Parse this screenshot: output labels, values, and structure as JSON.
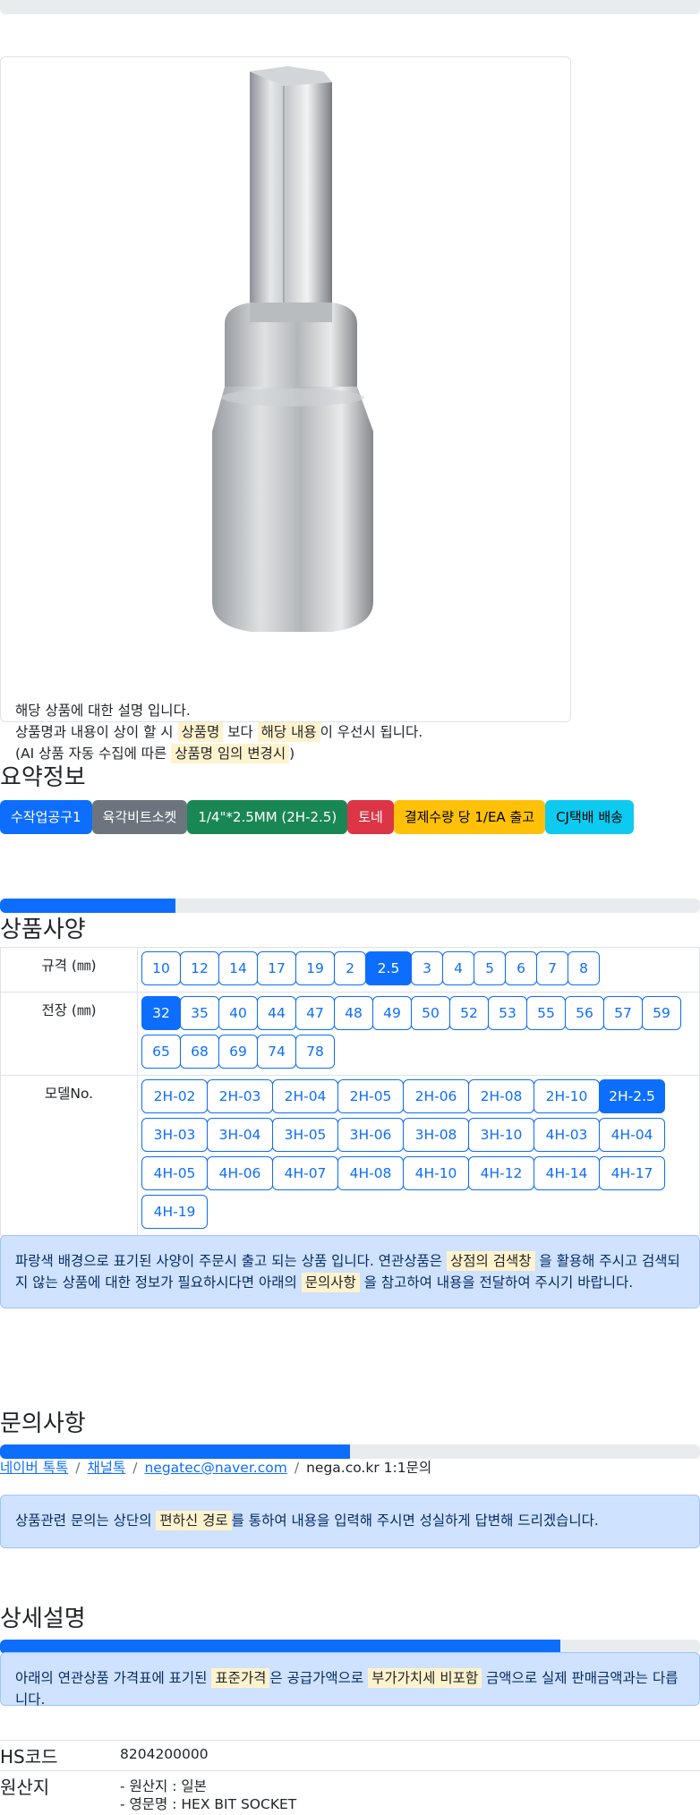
{
  "product": {
    "image_alt": "육각비트소켓",
    "desc_line1": "해당 상품에 대한 설명 입니다.",
    "desc_line2_a": "상품명과 내용이 상이 할 시 ",
    "desc_line2_mark1": "상품명",
    "desc_line2_b": " 보다 ",
    "desc_line2_mark2": "해당 내용",
    "desc_line2_c": "이 우선시 됩니다.",
    "desc_line3_a": "(AI 상품 자동 수집에 따른 ",
    "desc_line3_mark": "상품명 임의 변경시",
    "desc_line3_b": ")"
  },
  "summary": {
    "title": "요약정보",
    "badges": [
      {
        "label": "수작업공구1",
        "bg": "#0d6efd",
        "color": "#ffffff"
      },
      {
        "label": "육각비트소켓",
        "bg": "#6c757d",
        "color": "#ffffff"
      },
      {
        "label": "1/4\"*2.5MM (2H-2.5)",
        "bg": "#198754",
        "color": "#ffffff"
      },
      {
        "label": "토네",
        "bg": "#dc3545",
        "color": "#ffffff"
      },
      {
        "label": "결제수량 당 1/EA 출고",
        "bg": "#ffc107",
        "color": "#000000"
      },
      {
        "label": "CJ택배 배송",
        "bg": "#0dcaf0",
        "color": "#000000"
      }
    ]
  },
  "spec": {
    "title": "상품사양",
    "progress": 0.25,
    "rows": [
      {
        "label": "규격 (㎜)",
        "selected": "2.5",
        "options": [
          "10",
          "12",
          "14",
          "17",
          "19",
          "2",
          "2.5",
          "3",
          "4",
          "5",
          "6",
          "7",
          "8"
        ]
      },
      {
        "label": "전장 (㎜)",
        "selected": "32",
        "options": [
          "32",
          "35",
          "40",
          "44",
          "47",
          "48",
          "49",
          "50",
          "52",
          "53",
          "55",
          "56",
          "57",
          "59",
          "65",
          "68",
          "69",
          "74",
          "78"
        ]
      },
      {
        "label": "모델No.",
        "selected": "2H-2.5",
        "options": [
          "2H-02",
          "2H-03",
          "2H-04",
          "2H-05",
          "2H-06",
          "2H-08",
          "2H-10",
          "2H-2.5",
          "3H-03",
          "3H-04",
          "3H-05",
          "3H-06",
          "3H-08",
          "3H-10",
          "4H-03",
          "4H-04",
          "4H-05",
          "4H-06",
          "4H-07",
          "4H-08",
          "4H-10",
          "4H-12",
          "4H-14",
          "4H-17",
          "4H-19"
        ]
      }
    ],
    "notice_a": "파랑색 배경으로 표기된 사양이 주문시 출고 되는 상품 입니다. 연관상품은 ",
    "notice_mark1": "상점의 검색창",
    "notice_b": " 을 활용해 주시고 검색되지 않는 상품에 대한 정보가 필요하시다면 아래의 ",
    "notice_mark2": "문의사항",
    "notice_c": " 을 참고하여 내용을 전달하여 주시기 바랍니다."
  },
  "inquiry": {
    "title": "문의사항",
    "progress": 0.5,
    "links": [
      "네이버 톡톡",
      "채널톡",
      "negatec@naver.com"
    ],
    "plain": "nega.co.kr 1:1문의",
    "notice_a": "상품관련 문의는 상단의 ",
    "notice_mark": "편하신 경로",
    "notice_b": "를 통하여 내용을 입력해 주시면 성실하게 답변해 드리겠습니다."
  },
  "detail": {
    "title": "상세설명",
    "progress": 0.8,
    "notice_a": "아래의 연관상품 가격표에 표기된 ",
    "notice_mark1": "표준가격",
    "notice_b": "은 공급가액으로 ",
    "notice_mark2": "부가가치세 비포함",
    "notice_c": " 금액으로 실제 판매금액과는 다릅니다.",
    "hs_label": "HS코드",
    "hs_value": "8204200000",
    "origin_label": "원산지",
    "origin_line1": "- 원산지 : 일본",
    "origin_line2": "- 영문명 : HEX BIT SOCKET"
  }
}
